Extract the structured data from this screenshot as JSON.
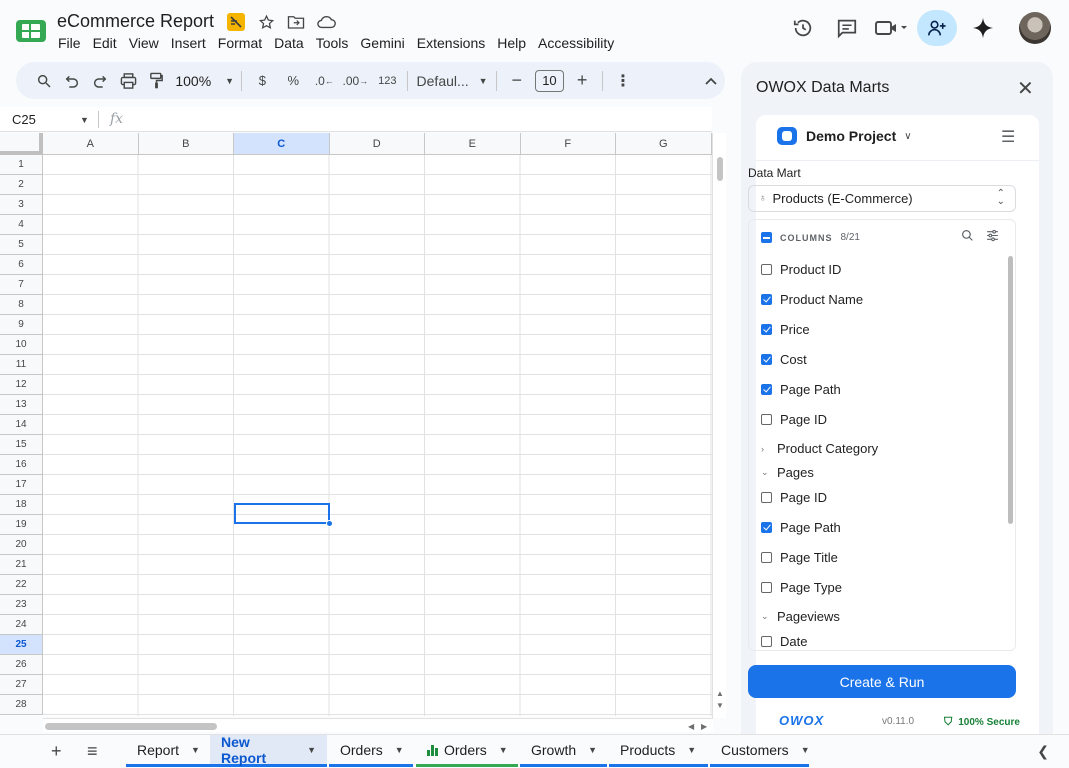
{
  "document": {
    "title": "eCommerce Report",
    "menu": [
      "File",
      "Edit",
      "View",
      "Insert",
      "Format",
      "Data",
      "Tools",
      "Gemini",
      "Extensions",
      "Help",
      "Accessibility"
    ]
  },
  "toolbar": {
    "zoom": "100%",
    "currency_label": "$",
    "percent_label": "%",
    "decimal_decrease_label": ".0",
    "decimal_increase_label": ".00",
    "number_format_label": "123",
    "font_family": "Defaul...",
    "font_size": "10"
  },
  "formula_bar": {
    "name_box": "C25",
    "fx": "fx"
  },
  "grid": {
    "columns": [
      "A",
      "B",
      "C",
      "D",
      "E",
      "F",
      "G"
    ],
    "rows": [
      "1",
      "2",
      "3",
      "4",
      "5",
      "6",
      "7",
      "8",
      "9",
      "10",
      "11",
      "12",
      "13",
      "14",
      "15",
      "16",
      "17",
      "18",
      "19",
      "20",
      "21",
      "22",
      "23",
      "24",
      "25",
      "26",
      "27",
      "28"
    ],
    "selected_column": "C",
    "selected_row": "25"
  },
  "sheets": {
    "tabs": [
      {
        "label": "Report",
        "active": false,
        "color": "#1a73e8",
        "chart_icon": false
      },
      {
        "label": "New Report",
        "active": true,
        "color": "#1a73e8",
        "chart_icon": false
      },
      {
        "label": "Orders",
        "active": false,
        "color": "#1a73e8",
        "chart_icon": false
      },
      {
        "label": "Orders",
        "active": false,
        "color": "#34a853",
        "chart_icon": true
      },
      {
        "label": "Growth",
        "active": false,
        "color": "#1a73e8",
        "chart_icon": false
      },
      {
        "label": "Products",
        "active": false,
        "color": "#1a73e8",
        "chart_icon": false
      },
      {
        "label": "Customers",
        "active": false,
        "color": "#1a73e8",
        "chart_icon": false
      }
    ]
  },
  "panel": {
    "title": "OWOX Data Marts",
    "project": "Demo Project",
    "data_mart_label": "Data Mart",
    "data_mart_value": "Products (E-Commerce)",
    "columns_title": "COLUMNS",
    "columns_count": "8/21",
    "items": [
      {
        "type": "check",
        "label": "Product ID",
        "checked": false
      },
      {
        "type": "check",
        "label": "Product Name",
        "checked": true
      },
      {
        "type": "check",
        "label": "Price",
        "checked": true
      },
      {
        "type": "check",
        "label": "Cost",
        "checked": true
      },
      {
        "type": "check",
        "label": "Page Path",
        "checked": true
      },
      {
        "type": "check",
        "label": "Page ID",
        "checked": false
      },
      {
        "type": "group",
        "label": "Product Category",
        "expanded": false
      },
      {
        "type": "group",
        "label": "Pages",
        "expanded": true
      },
      {
        "type": "check",
        "label": "Page ID",
        "checked": false
      },
      {
        "type": "check",
        "label": "Page Path",
        "checked": true
      },
      {
        "type": "check",
        "label": "Page Title",
        "checked": false
      },
      {
        "type": "check",
        "label": "Page Type",
        "checked": false
      },
      {
        "type": "group",
        "label": "Pageviews",
        "expanded": true
      },
      {
        "type": "check",
        "label": "Date",
        "checked": false
      }
    ],
    "run_button": "Create & Run",
    "footer_logo": "OWOX",
    "version": "v0.11.0",
    "secure": "100% Secure"
  },
  "colors": {
    "accent": "#1a73e8",
    "share_bg": "#c2e7ff",
    "secure": "#188038"
  }
}
